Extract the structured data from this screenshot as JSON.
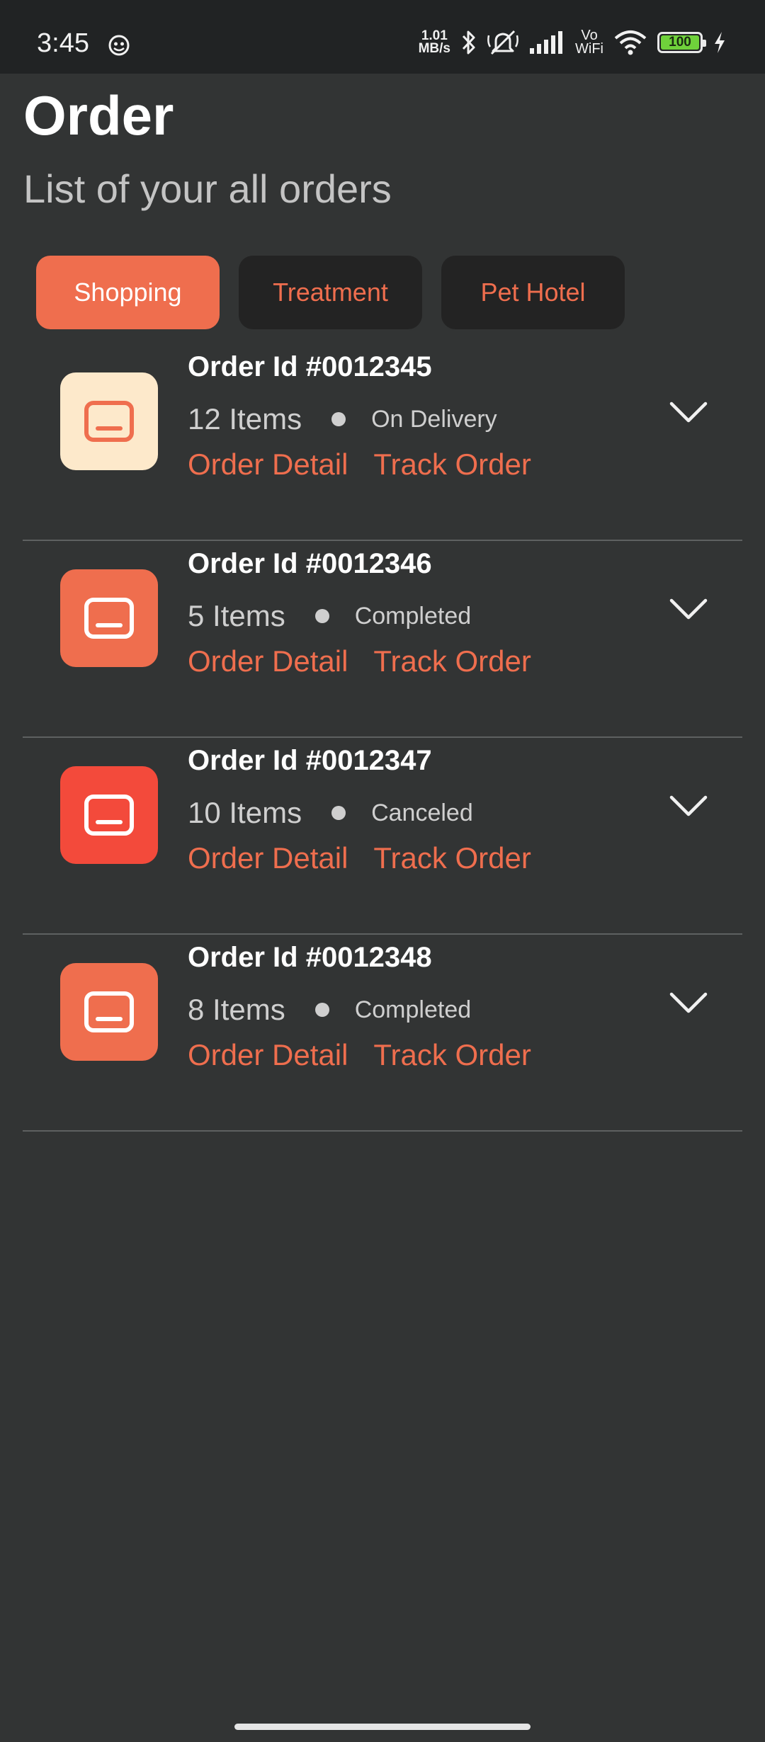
{
  "status_bar": {
    "time": "3:45",
    "net_speed_value": "1.01",
    "net_speed_unit": "MB/s",
    "vowifi_top": "Vo",
    "vowifi_bottom": "WiFi",
    "battery": "100",
    "icons": [
      "app-notification-icon",
      "bluetooth-icon",
      "silent-mode-icon",
      "signal-icon",
      "wifi-icon",
      "charging-icon"
    ]
  },
  "header": {
    "title": "Order",
    "subtitle": "List of your all orders"
  },
  "tabs": [
    {
      "label": "Shopping",
      "active": true
    },
    {
      "label": "Treatment",
      "active": false
    },
    {
      "label": "Pet Hotel",
      "active": false
    }
  ],
  "orders": [
    {
      "id": "Order Id #0012345",
      "items": "12 Items",
      "status": "On Delivery",
      "detail_label": "Order Detail",
      "track_label": "Track Order",
      "icon_bg": "#fde9cb",
      "icon_color": "#ef6e4e"
    },
    {
      "id": "Order Id #0012346",
      "items": "5 Items",
      "status": "Completed",
      "detail_label": "Order Detail",
      "track_label": "Track Order",
      "icon_bg": "#ef6e4e",
      "icon_color": "#ffffff"
    },
    {
      "id": "Order Id #0012347",
      "items": "10 Items",
      "status": "Canceled",
      "detail_label": "Order Detail",
      "track_label": "Track Order",
      "icon_bg": "#f34a3b",
      "icon_color": "#ffffff"
    },
    {
      "id": "Order Id #0012348",
      "items": "8 Items",
      "status": "Completed",
      "detail_label": "Order Detail",
      "track_label": "Track Order",
      "icon_bg": "#ef6e4e",
      "icon_color": "#ffffff"
    }
  ],
  "colors": {
    "accent": "#ef6e4e",
    "background": "#323434",
    "status_bar": "#212324",
    "tab_inactive": "#232323",
    "divider": "#5e6161"
  }
}
